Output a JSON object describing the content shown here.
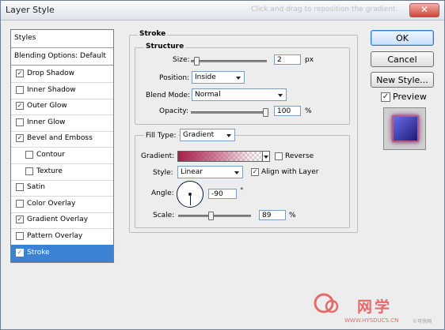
{
  "window": {
    "title": "Layer Style",
    "title_hint": "Click and drag to reposition the gradient.",
    "close_label": "✕"
  },
  "styles_panel": {
    "header": "Styles",
    "blending_options": "Blending Options: Default",
    "items": [
      {
        "label": "Drop Shadow",
        "checked": true,
        "indent": false,
        "selected": false
      },
      {
        "label": "Inner Shadow",
        "checked": false,
        "indent": false,
        "selected": false
      },
      {
        "label": "Outer Glow",
        "checked": true,
        "indent": false,
        "selected": false
      },
      {
        "label": "Inner Glow",
        "checked": false,
        "indent": false,
        "selected": false
      },
      {
        "label": "Bevel and Emboss",
        "checked": true,
        "indent": false,
        "selected": false
      },
      {
        "label": "Contour",
        "checked": false,
        "indent": true,
        "selected": false
      },
      {
        "label": "Texture",
        "checked": false,
        "indent": true,
        "selected": false
      },
      {
        "label": "Satin",
        "checked": false,
        "indent": false,
        "selected": false
      },
      {
        "label": "Color Overlay",
        "checked": false,
        "indent": false,
        "selected": false
      },
      {
        "label": "Gradient Overlay",
        "checked": true,
        "indent": false,
        "selected": false
      },
      {
        "label": "Pattern Overlay",
        "checked": false,
        "indent": false,
        "selected": false
      },
      {
        "label": "Stroke",
        "checked": true,
        "indent": false,
        "selected": true
      }
    ]
  },
  "stroke": {
    "group_title": "Stroke",
    "structure": {
      "title": "Structure",
      "size_label": "Size:",
      "size_value": "2",
      "size_unit": "px",
      "size_slider_fraction": 0.05,
      "position_label": "Position:",
      "position_value": "Inside",
      "blend_label": "Blend Mode:",
      "blend_value": "Normal",
      "opacity_label": "Opacity:",
      "opacity_value": "100",
      "opacity_unit": "%",
      "opacity_slider_fraction": 1.0
    },
    "fill": {
      "fill_type_label": "Fill Type:",
      "fill_type_value": "Gradient",
      "gradient_label": "Gradient:",
      "reverse_label": "Reverse",
      "reverse_checked": false,
      "style_label": "Style:",
      "style_value": "Linear",
      "align_label": "Align with Layer",
      "align_checked": true,
      "angle_label": "Angle:",
      "angle_value": "-90",
      "angle_unit": "°",
      "scale_label": "Scale:",
      "scale_value": "89",
      "scale_unit": "%",
      "scale_slider_fraction": 0.45
    }
  },
  "buttons": {
    "ok": "OK",
    "cancel": "Cancel",
    "new_style": "New Style...",
    "preview_label": "Preview",
    "preview_checked": true
  },
  "watermark": {
    "brand": "网学",
    "url": "WWW.HYSDUCS.CN",
    "small": "©可快网"
  },
  "colors": {
    "accent": "#3c82d4",
    "gradient_start": "#a3214a",
    "watermark": "#e66a6a"
  }
}
